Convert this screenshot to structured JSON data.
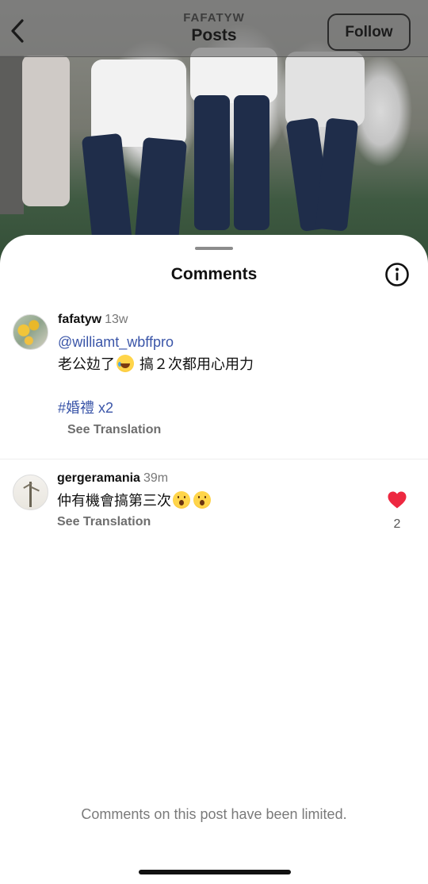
{
  "header": {
    "subtitle": "FAFATYW",
    "title": "Posts",
    "follow_label": "Follow"
  },
  "sheet": {
    "title": "Comments",
    "limited_notice": "Comments on this post have been limited."
  },
  "comments": [
    {
      "username": "fafatyw",
      "time": "13w",
      "mention": "@williamt_wbffpro",
      "text_before_emoji": "老公攰了",
      "emoji": "laughing-tears-emoji",
      "text_after_emoji": " 搞２次都用心用力",
      "hashtag": "#婚禮 x2",
      "see_translation": "See Translation"
    },
    {
      "username": "gergeramania",
      "time": "39m",
      "text": "仲有機會搞第三次",
      "emojis": [
        "astonished-emoji",
        "astonished-emoji"
      ],
      "see_translation": "See Translation",
      "liked": true,
      "like_count": "2"
    }
  ],
  "colors": {
    "link": "#3a55a8",
    "heart": "#ed2840",
    "muted": "#7a7a7a"
  }
}
